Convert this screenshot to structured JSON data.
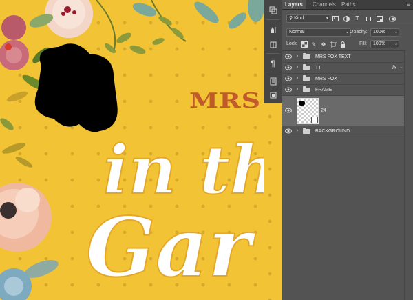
{
  "canvas": {
    "title_fragment": "MRS",
    "headline_line1": "in th",
    "headline_line2": "Gar"
  },
  "tools": [
    "history-icon",
    "brush-presets-icon",
    "paragraph-icon",
    "properties-icon",
    "adjustments-icon",
    "libraries-icon"
  ],
  "panel": {
    "tabs": [
      "Layers",
      "Channels",
      "Paths"
    ],
    "filter_kind": "Kind",
    "blend_mode": "Normal",
    "opacity_label": "Opacity:",
    "opacity_value": "100%",
    "lock_label": "Lock:",
    "fill_label": "Fill:",
    "fill_value": "100%",
    "layers": [
      {
        "name": "MRS FOX TEXT",
        "type": "group",
        "visible": true
      },
      {
        "name": "TT",
        "type": "group",
        "visible": true,
        "fx": "fx"
      },
      {
        "name": "MRS FOX",
        "type": "group",
        "visible": true
      },
      {
        "name": "FRAME",
        "type": "group",
        "visible": true
      },
      {
        "name": "24",
        "type": "smart-object",
        "visible": true,
        "selected": true
      },
      {
        "name": "BACKGROUND",
        "type": "group",
        "visible": true
      }
    ]
  },
  "colors": {
    "canvas_yellow": "#f2c335",
    "mrs_orange": "#c15a2a",
    "panel_bg": "#535353",
    "selected_row": "#6a6a6a"
  }
}
